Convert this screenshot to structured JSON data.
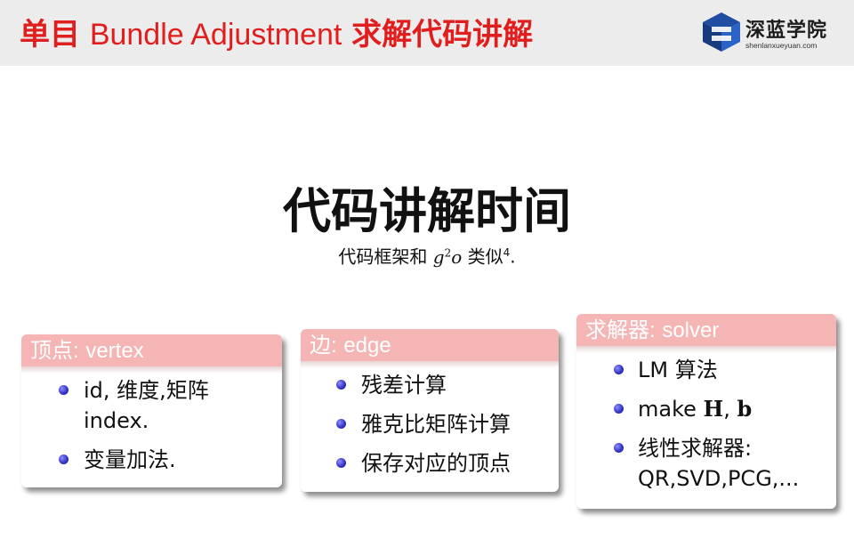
{
  "header": {
    "title_prefix": "单目",
    "title_en": "Bundle Adjustment",
    "title_suffix": "求解代码讲解",
    "logo_text": "深蓝学院",
    "logo_url": "shenlanxueyuan.com",
    "brand_colors": {
      "title_red": "#e01e1e",
      "logo_blue": "#1f4ea3",
      "block_header": "#f6b5b5"
    }
  },
  "main": {
    "title": "代码讲解时间",
    "subtitle_prefix": "代码框架和",
    "subtitle_math": "g",
    "subtitle_sup": "2",
    "subtitle_math2": "o",
    "subtitle_suffix": "类似",
    "subtitle_footnote": "4",
    "subtitle_end": "."
  },
  "blocks": [
    {
      "head_cn": "顶点",
      "head_sep": ":",
      "head_en": "vertex",
      "items": [
        "id, 维度,矩阵 index.",
        "变量加法."
      ]
    },
    {
      "head_cn": "边",
      "head_sep": ":",
      "head_en": "edge",
      "items": [
        "残差计算",
        "雅克比矩阵计算",
        "保存对应的顶点"
      ]
    },
    {
      "head_cn": "求解器",
      "head_sep": ":",
      "head_en": "solver",
      "items": {
        "lm": "LM 算法",
        "make_prefix": "make",
        "make_H": "H",
        "make_sep": ",",
        "make_b": "b",
        "linear": "线性求解器:",
        "linear_list": "QR,SVD,PCG,..."
      }
    }
  ],
  "icons": [
    "logo-icon",
    "bullet-icon"
  ]
}
